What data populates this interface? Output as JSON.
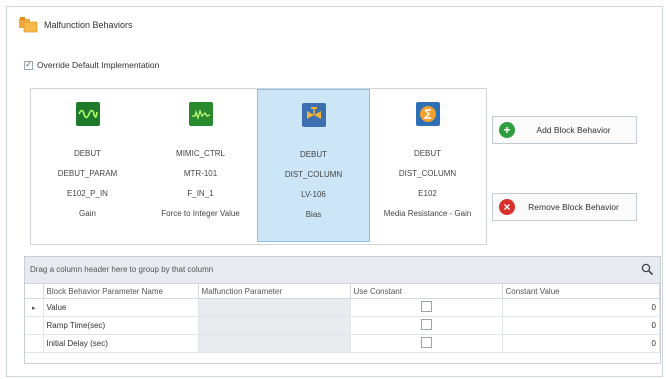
{
  "header": {
    "title": "Malfunction Behaviors",
    "icon": "malfunction-folder-icon"
  },
  "override": {
    "label": "Override Default Implementation",
    "checked": true,
    "check_glyph": "✓"
  },
  "blocks": [
    {
      "icon": "sine-wave-icon",
      "l1": "DEBUT",
      "l2": "DEBUT_PARAM",
      "l3": "E102_P_IN",
      "l4": "Gain",
      "selected": false
    },
    {
      "icon": "signal-trace-icon",
      "l1": "MIMIC_CTRL",
      "l2": "MTR-101",
      "l3": "F_IN_1",
      "l4": "Force to Integer Value",
      "selected": false
    },
    {
      "icon": "valve-icon",
      "l1": "DEBUT",
      "l2": "DIST_COLUMN",
      "l3": "LV-106",
      "l4": "Bias",
      "selected": true
    },
    {
      "icon": "summation-icon",
      "l1": "DEBUT",
      "l2": "DIST_COLUMN",
      "l3": "E102",
      "l4": "Media Resistance - Gain",
      "selected": false
    }
  ],
  "buttons": {
    "add": {
      "label": "Add Block Behavior",
      "glyph": "+",
      "color": "#2e9e3e"
    },
    "remove": {
      "label": "Remove Block Behavior",
      "glyph": "×",
      "color": "#d8312b"
    }
  },
  "grid": {
    "group_hint": "Drag a column header here to group by that column",
    "search_icon": "magnifier-icon",
    "columns": [
      "Block Behavior Parameter Name",
      "Malfunction Parameter",
      "Use Constant",
      "Constant Value"
    ],
    "rows": [
      {
        "indicator": "▸",
        "name": "Value",
        "malfunction": "",
        "use_constant": false,
        "value": "0"
      },
      {
        "indicator": "",
        "name": "Ramp Time(sec)",
        "malfunction": "",
        "use_constant": false,
        "value": "0"
      },
      {
        "indicator": "",
        "name": "Initial Delay (sec)",
        "malfunction": "",
        "use_constant": false,
        "value": "0"
      }
    ]
  },
  "colors": {
    "selected_bg": "#cde6f7",
    "accent_green": "#2e9e3e",
    "accent_red": "#d8312b"
  }
}
